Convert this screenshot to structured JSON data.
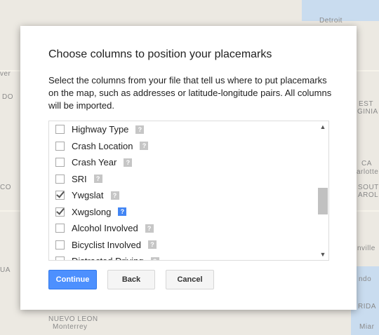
{
  "map": {
    "labels": [
      "Detroit",
      "ver",
      "DO",
      "EST",
      "GINIA",
      "CA",
      "arlotte",
      "CO",
      "SOUTH",
      "AROLI",
      "nville",
      "UA",
      "ndo",
      "RIDA",
      "NUEVO LEON",
      "Monterrey",
      "Miar"
    ]
  },
  "dialog": {
    "title": "Choose columns to position your placemarks",
    "description": "Select the columns from your file that tell us where to put placemarks on the map, such as addresses or latitude-longitude pairs. All columns will be imported.",
    "columns": [
      {
        "label": "Highway Type",
        "checked": false,
        "help_active": false
      },
      {
        "label": "Crash Location",
        "checked": false,
        "help_active": false
      },
      {
        "label": "Crash Year",
        "checked": false,
        "help_active": false
      },
      {
        "label": "SRI",
        "checked": false,
        "help_active": false
      },
      {
        "label": "Ywgslat",
        "checked": true,
        "help_active": false
      },
      {
        "label": "Xwgslong",
        "checked": true,
        "help_active": true
      },
      {
        "label": "Alcohol Involved",
        "checked": false,
        "help_active": false
      },
      {
        "label": "Bicyclist Involved",
        "checked": false,
        "help_active": false
      },
      {
        "label": "Distracted Driving",
        "checked": false,
        "help_active": false
      }
    ],
    "help_glyph": "?",
    "scroll_up_glyph": "▲",
    "scroll_down_glyph": "▼",
    "buttons": {
      "continue": "Continue",
      "back": "Back",
      "cancel": "Cancel"
    }
  },
  "colors": {
    "primary": "#4d90fe",
    "help_active": "#4285f4"
  }
}
